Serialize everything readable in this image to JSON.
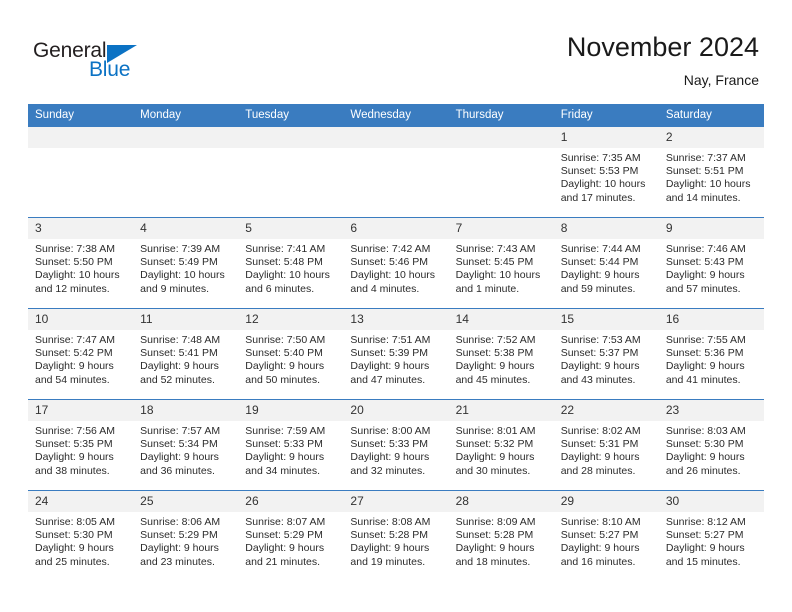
{
  "logo": {
    "word_one": "General",
    "word_two": "Blue",
    "accent_color": "#0b72c4",
    "triangle_icon": "triangle-icon"
  },
  "header": {
    "title": "November 2024",
    "subtitle": "Nay, France",
    "header_bg_color": "#3a7cc0"
  },
  "weekday_headers": [
    "Sunday",
    "Monday",
    "Tuesday",
    "Wednesday",
    "Thursday",
    "Friday",
    "Saturday"
  ],
  "labels": {
    "sunrise": "Sunrise:",
    "sunset": "Sunset:",
    "daylight": "Daylight:"
  },
  "weeks": [
    [
      {
        "day": "",
        "sunrise": "",
        "sunset": "",
        "daylight_1": "",
        "daylight_2": ""
      },
      {
        "day": "",
        "sunrise": "",
        "sunset": "",
        "daylight_1": "",
        "daylight_2": ""
      },
      {
        "day": "",
        "sunrise": "",
        "sunset": "",
        "daylight_1": "",
        "daylight_2": ""
      },
      {
        "day": "",
        "sunrise": "",
        "sunset": "",
        "daylight_1": "",
        "daylight_2": ""
      },
      {
        "day": "",
        "sunrise": "",
        "sunset": "",
        "daylight_1": "",
        "daylight_2": ""
      },
      {
        "day": "1",
        "sunrise": "Sunrise: 7:35 AM",
        "sunset": "Sunset: 5:53 PM",
        "daylight_1": "Daylight: 10 hours",
        "daylight_2": "and 17 minutes."
      },
      {
        "day": "2",
        "sunrise": "Sunrise: 7:37 AM",
        "sunset": "Sunset: 5:51 PM",
        "daylight_1": "Daylight: 10 hours",
        "daylight_2": "and 14 minutes."
      }
    ],
    [
      {
        "day": "3",
        "sunrise": "Sunrise: 7:38 AM",
        "sunset": "Sunset: 5:50 PM",
        "daylight_1": "Daylight: 10 hours",
        "daylight_2": "and 12 minutes."
      },
      {
        "day": "4",
        "sunrise": "Sunrise: 7:39 AM",
        "sunset": "Sunset: 5:49 PM",
        "daylight_1": "Daylight: 10 hours",
        "daylight_2": "and 9 minutes."
      },
      {
        "day": "5",
        "sunrise": "Sunrise: 7:41 AM",
        "sunset": "Sunset: 5:48 PM",
        "daylight_1": "Daylight: 10 hours",
        "daylight_2": "and 6 minutes."
      },
      {
        "day": "6",
        "sunrise": "Sunrise: 7:42 AM",
        "sunset": "Sunset: 5:46 PM",
        "daylight_1": "Daylight: 10 hours",
        "daylight_2": "and 4 minutes."
      },
      {
        "day": "7",
        "sunrise": "Sunrise: 7:43 AM",
        "sunset": "Sunset: 5:45 PM",
        "daylight_1": "Daylight: 10 hours",
        "daylight_2": "and 1 minute."
      },
      {
        "day": "8",
        "sunrise": "Sunrise: 7:44 AM",
        "sunset": "Sunset: 5:44 PM",
        "daylight_1": "Daylight: 9 hours",
        "daylight_2": "and 59 minutes."
      },
      {
        "day": "9",
        "sunrise": "Sunrise: 7:46 AM",
        "sunset": "Sunset: 5:43 PM",
        "daylight_1": "Daylight: 9 hours",
        "daylight_2": "and 57 minutes."
      }
    ],
    [
      {
        "day": "10",
        "sunrise": "Sunrise: 7:47 AM",
        "sunset": "Sunset: 5:42 PM",
        "daylight_1": "Daylight: 9 hours",
        "daylight_2": "and 54 minutes."
      },
      {
        "day": "11",
        "sunrise": "Sunrise: 7:48 AM",
        "sunset": "Sunset: 5:41 PM",
        "daylight_1": "Daylight: 9 hours",
        "daylight_2": "and 52 minutes."
      },
      {
        "day": "12",
        "sunrise": "Sunrise: 7:50 AM",
        "sunset": "Sunset: 5:40 PM",
        "daylight_1": "Daylight: 9 hours",
        "daylight_2": "and 50 minutes."
      },
      {
        "day": "13",
        "sunrise": "Sunrise: 7:51 AM",
        "sunset": "Sunset: 5:39 PM",
        "daylight_1": "Daylight: 9 hours",
        "daylight_2": "and 47 minutes."
      },
      {
        "day": "14",
        "sunrise": "Sunrise: 7:52 AM",
        "sunset": "Sunset: 5:38 PM",
        "daylight_1": "Daylight: 9 hours",
        "daylight_2": "and 45 minutes."
      },
      {
        "day": "15",
        "sunrise": "Sunrise: 7:53 AM",
        "sunset": "Sunset: 5:37 PM",
        "daylight_1": "Daylight: 9 hours",
        "daylight_2": "and 43 minutes."
      },
      {
        "day": "16",
        "sunrise": "Sunrise: 7:55 AM",
        "sunset": "Sunset: 5:36 PM",
        "daylight_1": "Daylight: 9 hours",
        "daylight_2": "and 41 minutes."
      }
    ],
    [
      {
        "day": "17",
        "sunrise": "Sunrise: 7:56 AM",
        "sunset": "Sunset: 5:35 PM",
        "daylight_1": "Daylight: 9 hours",
        "daylight_2": "and 38 minutes."
      },
      {
        "day": "18",
        "sunrise": "Sunrise: 7:57 AM",
        "sunset": "Sunset: 5:34 PM",
        "daylight_1": "Daylight: 9 hours",
        "daylight_2": "and 36 minutes."
      },
      {
        "day": "19",
        "sunrise": "Sunrise: 7:59 AM",
        "sunset": "Sunset: 5:33 PM",
        "daylight_1": "Daylight: 9 hours",
        "daylight_2": "and 34 minutes."
      },
      {
        "day": "20",
        "sunrise": "Sunrise: 8:00 AM",
        "sunset": "Sunset: 5:33 PM",
        "daylight_1": "Daylight: 9 hours",
        "daylight_2": "and 32 minutes."
      },
      {
        "day": "21",
        "sunrise": "Sunrise: 8:01 AM",
        "sunset": "Sunset: 5:32 PM",
        "daylight_1": "Daylight: 9 hours",
        "daylight_2": "and 30 minutes."
      },
      {
        "day": "22",
        "sunrise": "Sunrise: 8:02 AM",
        "sunset": "Sunset: 5:31 PM",
        "daylight_1": "Daylight: 9 hours",
        "daylight_2": "and 28 minutes."
      },
      {
        "day": "23",
        "sunrise": "Sunrise: 8:03 AM",
        "sunset": "Sunset: 5:30 PM",
        "daylight_1": "Daylight: 9 hours",
        "daylight_2": "and 26 minutes."
      }
    ],
    [
      {
        "day": "24",
        "sunrise": "Sunrise: 8:05 AM",
        "sunset": "Sunset: 5:30 PM",
        "daylight_1": "Daylight: 9 hours",
        "daylight_2": "and 25 minutes."
      },
      {
        "day": "25",
        "sunrise": "Sunrise: 8:06 AM",
        "sunset": "Sunset: 5:29 PM",
        "daylight_1": "Daylight: 9 hours",
        "daylight_2": "and 23 minutes."
      },
      {
        "day": "26",
        "sunrise": "Sunrise: 8:07 AM",
        "sunset": "Sunset: 5:29 PM",
        "daylight_1": "Daylight: 9 hours",
        "daylight_2": "and 21 minutes."
      },
      {
        "day": "27",
        "sunrise": "Sunrise: 8:08 AM",
        "sunset": "Sunset: 5:28 PM",
        "daylight_1": "Daylight: 9 hours",
        "daylight_2": "and 19 minutes."
      },
      {
        "day": "28",
        "sunrise": "Sunrise: 8:09 AM",
        "sunset": "Sunset: 5:28 PM",
        "daylight_1": "Daylight: 9 hours",
        "daylight_2": "and 18 minutes."
      },
      {
        "day": "29",
        "sunrise": "Sunrise: 8:10 AM",
        "sunset": "Sunset: 5:27 PM",
        "daylight_1": "Daylight: 9 hours",
        "daylight_2": "and 16 minutes."
      },
      {
        "day": "30",
        "sunrise": "Sunrise: 8:12 AM",
        "sunset": "Sunset: 5:27 PM",
        "daylight_1": "Daylight: 9 hours",
        "daylight_2": "and 15 minutes."
      }
    ]
  ]
}
